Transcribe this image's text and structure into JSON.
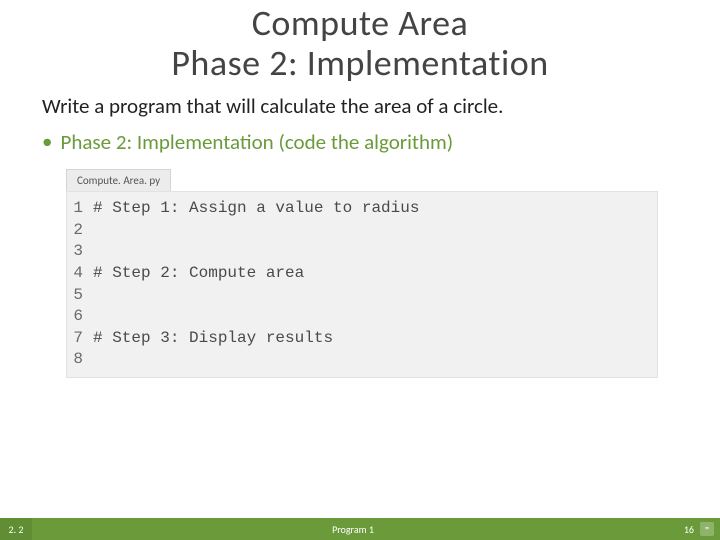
{
  "title": {
    "line1": "Compute Area",
    "line2": "Phase 2: Implementation"
  },
  "lead": "Write a program that will calculate the area of a circle.",
  "bullet": "Phase 2: Implementation (code the algorithm)",
  "filename": "Compute. Area. py",
  "code": {
    "lines": [
      {
        "n": "1",
        "t": "# Step 1: Assign a value to radius"
      },
      {
        "n": "2",
        "t": ""
      },
      {
        "n": "3",
        "t": ""
      },
      {
        "n": "4",
        "t": "# Step 2: Compute area"
      },
      {
        "n": "5",
        "t": ""
      },
      {
        "n": "6",
        "t": ""
      },
      {
        "n": "7",
        "t": "# Step 3: Display results"
      },
      {
        "n": "8",
        "t": ""
      }
    ]
  },
  "footer": {
    "left": "2. 2",
    "center": "Program 1",
    "right": "16",
    "badge": "="
  }
}
